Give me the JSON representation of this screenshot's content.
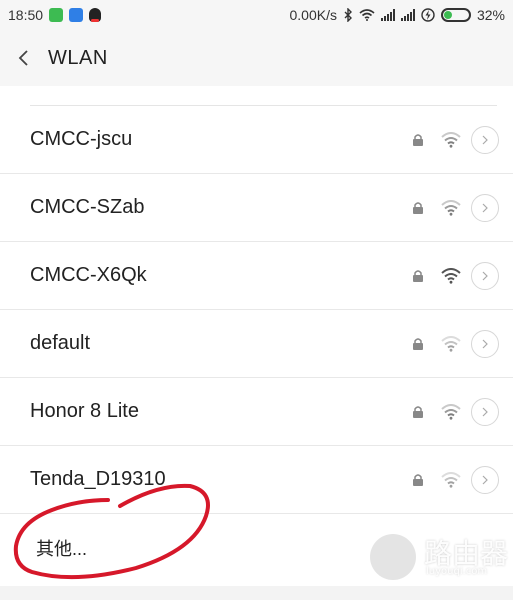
{
  "status_bar": {
    "time": "18:50",
    "speed": "0.00K/s",
    "battery": "32%",
    "icons": [
      "green-app-icon",
      "blue-shield-icon",
      "qq-icon",
      "bluetooth-icon",
      "wifi-icon",
      "signal-icon",
      "signal-icon",
      "charging-icon",
      "battery-icon"
    ]
  },
  "header": {
    "title": "WLAN",
    "back_icon": "back-arrow-icon"
  },
  "networks": [
    {
      "ssid": "CMCC-jscu",
      "locked": true
    },
    {
      "ssid": "CMCC-SZab",
      "locked": true
    },
    {
      "ssid": "CMCC-X6Qk",
      "locked": true
    },
    {
      "ssid": "default",
      "locked": true
    },
    {
      "ssid": "Honor 8 Lite",
      "locked": true
    },
    {
      "ssid": "Tenda_D19310",
      "locked": true
    }
  ],
  "other": {
    "label": "其他..."
  },
  "watermark": {
    "title": "路由器",
    "subtitle": "luyouqi.com"
  },
  "colors": {
    "annotation_red": "#d6182a",
    "appbar_bg": "#f6f6f6",
    "divider": "#e8e8e8"
  }
}
